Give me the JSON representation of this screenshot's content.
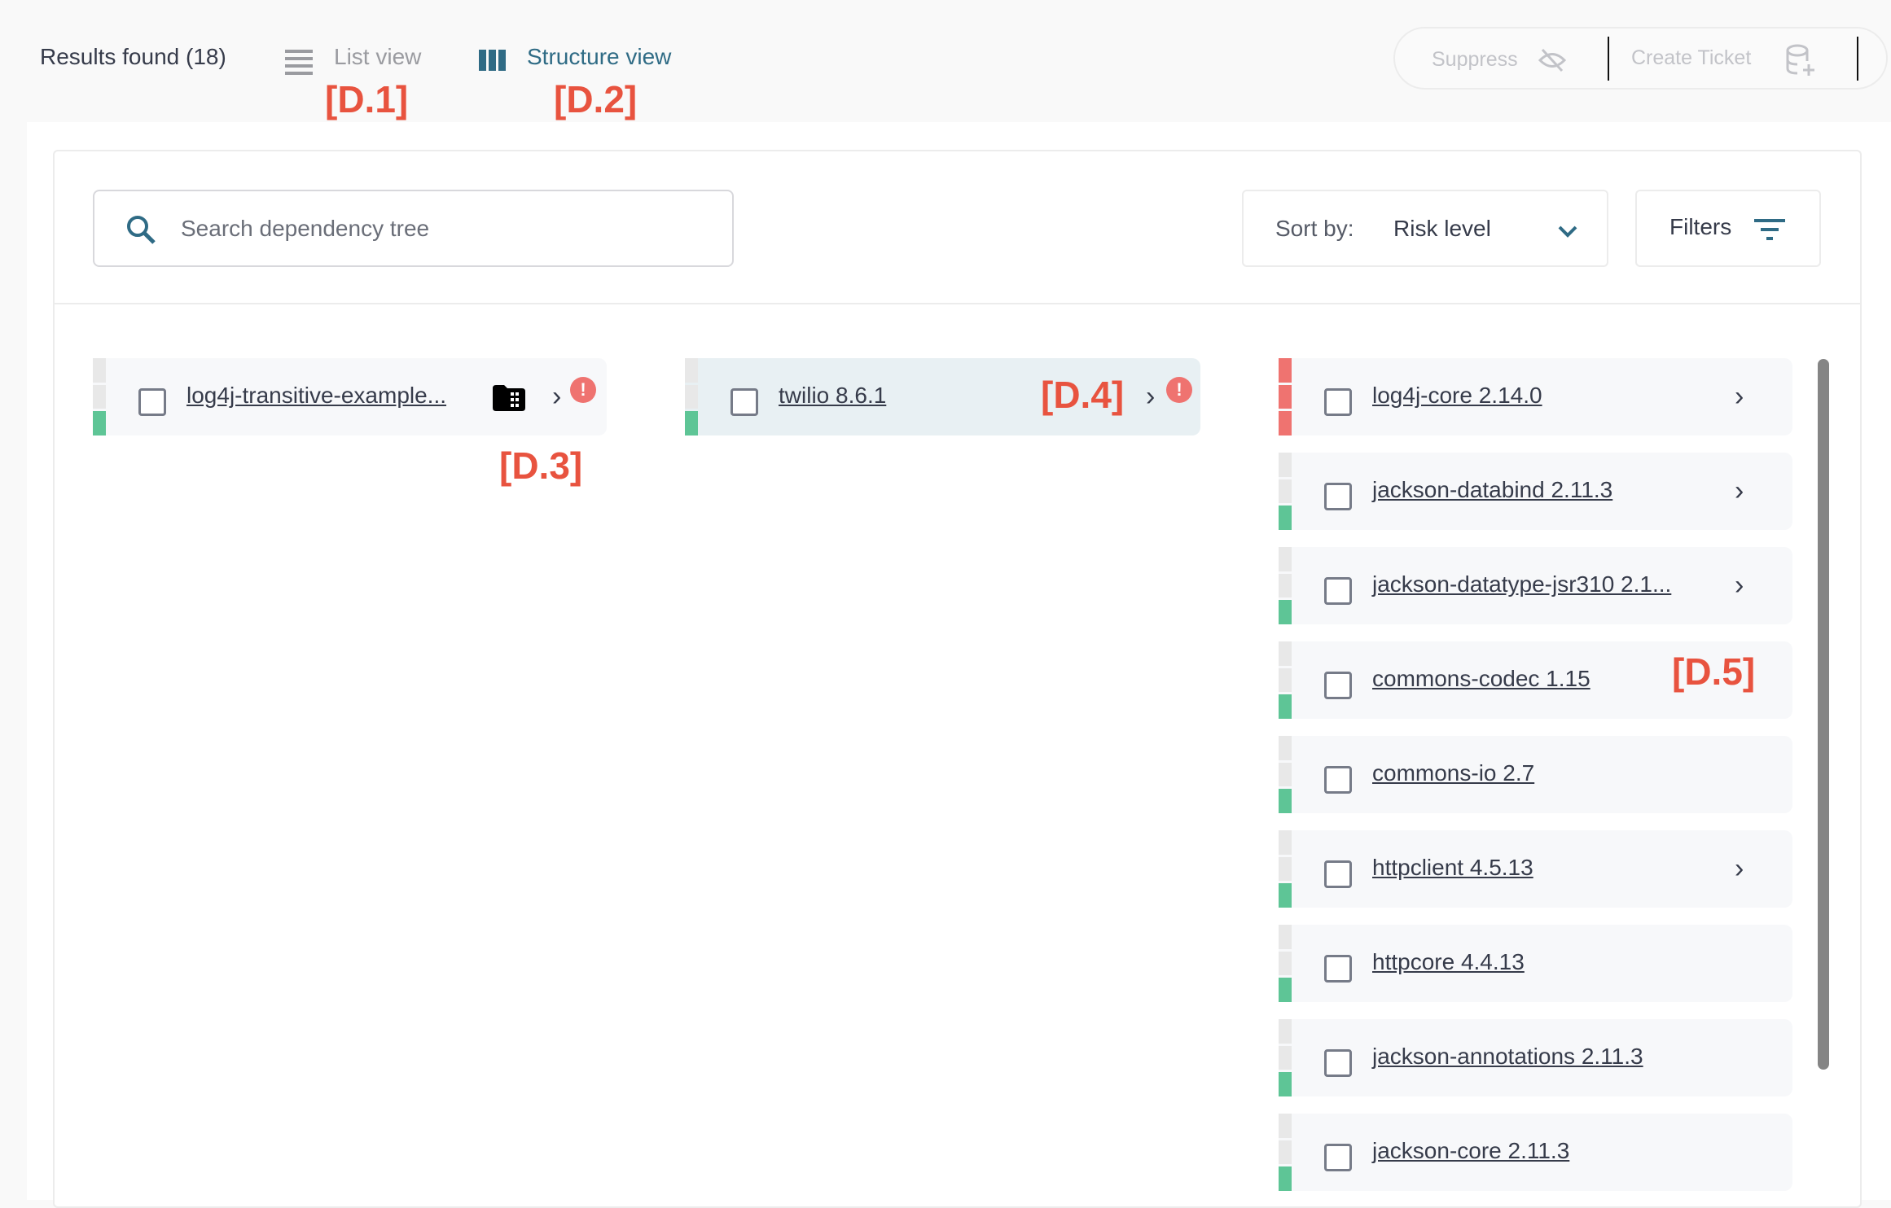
{
  "header": {
    "results_label": "Results found (18)",
    "list_view_label": "List view",
    "structure_view_label": "Structure view",
    "active_view": "structure"
  },
  "actions": {
    "suppress_label": "Suppress",
    "create_ticket_label": "Create Ticket"
  },
  "annotations": {
    "d1": "[D.1]",
    "d2": "[D.2]",
    "d3": "[D.3]",
    "d4": "[D.4]",
    "d5": "[D.5]"
  },
  "search": {
    "placeholder": "Search dependency tree"
  },
  "sort": {
    "label": "Sort by:",
    "value": "Risk level"
  },
  "filters": {
    "label": "Filters"
  },
  "colors": {
    "accent": "#2f6b85",
    "high_risk": "#ef7370",
    "low_risk": "#5ec596",
    "none": "#e8e8e8",
    "annotation": "#e8533f"
  },
  "columns": [
    {
      "items": [
        {
          "name": "log4j-transitive-example...",
          "risk": "low",
          "icon": "building-icon",
          "chevron": true,
          "alert": true
        }
      ]
    },
    {
      "items": [
        {
          "name": "twilio 8.6.1",
          "risk": "low",
          "chevron": true,
          "alert": true,
          "selected": true
        }
      ]
    },
    {
      "items": [
        {
          "name": "log4j-core 2.14.0",
          "risk": "high",
          "chevron": true
        },
        {
          "name": "jackson-databind 2.11.3",
          "risk": "low",
          "chevron": true
        },
        {
          "name": "jackson-datatype-jsr310 2.1...",
          "risk": "low",
          "chevron": true
        },
        {
          "name": "commons-codec 1.15",
          "risk": "low",
          "chevron": false
        },
        {
          "name": "commons-io 2.7",
          "risk": "low",
          "chevron": false
        },
        {
          "name": "httpclient 4.5.13",
          "risk": "low",
          "chevron": true
        },
        {
          "name": "httpcore 4.4.13",
          "risk": "low",
          "chevron": false
        },
        {
          "name": "jackson-annotations 2.11.3",
          "risk": "low",
          "chevron": false
        },
        {
          "name": "jackson-core 2.11.3",
          "risk": "low",
          "chevron": false
        }
      ]
    }
  ]
}
